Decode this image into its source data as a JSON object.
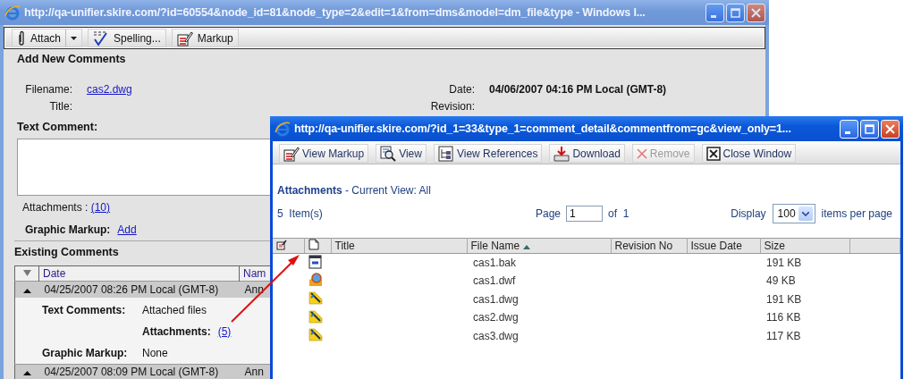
{
  "back_window": {
    "title": "http://qa-unifier.skire.com/?id=60554&node_id=81&node_type=2&edit=1&from=dms&model=dm_file&type - Windows I...",
    "active": false,
    "toolbar": [
      {
        "label": "Attach",
        "kind": "attach",
        "dropdown": true
      },
      {
        "label": "Spelling...",
        "kind": "spelling",
        "dropdown": false
      },
      {
        "label": "Markup",
        "kind": "markup",
        "dropdown": false
      }
    ],
    "section_title": "Add New Comments",
    "fields": [
      {
        "label": "Filename:",
        "link": "cas2.dwg"
      },
      {
        "label": "Title:"
      }
    ],
    "side_fields": [
      {
        "label": "Date:",
        "value": "04/06/2007 04:16 PM Local (GMT-8)"
      },
      {
        "label": "Revision:"
      }
    ],
    "text_comment_label": "Text Comment:",
    "attachments": {
      "label": "Attachments : ",
      "link": "(10)"
    },
    "graphic_markup": {
      "label": "Graphic Markup:",
      "link": "Add"
    },
    "existing_title": "Existing Comments",
    "table": {
      "columns": [
        "Date",
        "Nam"
      ],
      "groups": [
        {
          "date": "04/25/2007 08:26 PM Local (GMT-8)",
          "name": "Ann",
          "details": [
            {
              "label": "Text Comments:",
              "value": "Attached files"
            },
            {
              "sublabel": "Attachments:",
              "link": "(5)"
            },
            {
              "label": "Graphic Markup:",
              "value": "None"
            }
          ]
        },
        {
          "date": "04/25/2007 08:09 PM Local (GMT-8)",
          "name": "Ann"
        }
      ]
    }
  },
  "front_window": {
    "title": "http://qa-unifier.skire.com/?id_1=33&type_1=comment_detail&commentfrom=gc&view_only=1...",
    "active": true,
    "toolbar": [
      {
        "label": "View Markup",
        "kind": "markup",
        "disabled": false
      },
      {
        "label": "View",
        "kind": "view",
        "disabled": false
      },
      {
        "label": "View References",
        "kind": "references",
        "disabled": false
      },
      {
        "label": "Download",
        "kind": "download",
        "disabled": false
      },
      {
        "label": "Remove",
        "kind": "remove",
        "disabled": true
      },
      {
        "label": "Close Window",
        "kind": "close",
        "disabled": false
      }
    ],
    "heading": "Attachments",
    "view_label": "- Current View:",
    "view_value": "All",
    "item_count": "5  Item(s)",
    "page_label": "Page",
    "page_value": "1",
    "page_of": "of  1",
    "display_label": "Display",
    "display_value": "100",
    "per_page": "items per page",
    "columns": [
      {
        "kind": "markup"
      },
      {
        "kind": "page"
      },
      {
        "kind": "text",
        "label": "Title",
        "sorted": false
      },
      {
        "kind": "text",
        "label": "File Name",
        "sorted": true
      },
      {
        "kind": "text",
        "label": "Revision No",
        "sorted": false
      },
      {
        "kind": "text",
        "label": "Issue Date",
        "sorted": false
      },
      {
        "kind": "text",
        "label": "Size",
        "sorted": false
      }
    ],
    "rows": [
      {
        "kind": "document",
        "file_name": "cas1.bak",
        "size": "191 KB"
      },
      {
        "kind": "globe",
        "file_name": "cas1.dwf",
        "size": "49 KB"
      },
      {
        "kind": "drawing",
        "file_name": "cas1.dwg",
        "size": "191 KB"
      },
      {
        "kind": "drawing",
        "file_name": "cas2.dwg",
        "size": "116 KB"
      },
      {
        "kind": "drawing",
        "file_name": "cas3.dwg",
        "size": "117 KB"
      }
    ]
  }
}
